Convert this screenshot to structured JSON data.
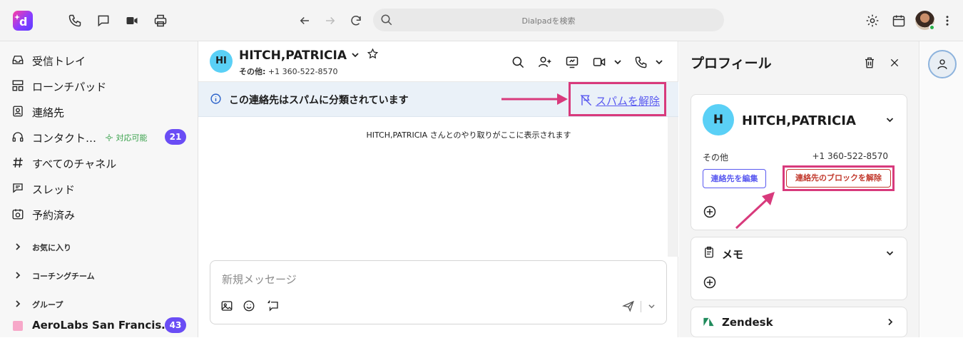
{
  "topbar": {
    "search_placeholder": "Dialpadを検索"
  },
  "sidebar": {
    "items": [
      {
        "label": "受信トレイ",
        "icon": "inbox-icon"
      },
      {
        "label": "ローンチパッド",
        "icon": "launchpad-icon"
      },
      {
        "label": "連絡先",
        "icon": "contacts-icon"
      },
      {
        "label": "コンタクト…",
        "icon": "headset-icon",
        "status": "対応可能",
        "badge": "21"
      },
      {
        "label": "すべてのチャネル",
        "icon": "hash-icon"
      },
      {
        "label": "スレッド",
        "icon": "threads-icon"
      },
      {
        "label": "予約済み",
        "icon": "scheduled-icon"
      }
    ],
    "sections": [
      {
        "label": "お気に入り"
      },
      {
        "label": "コーチングチーム"
      },
      {
        "label": "グループ"
      }
    ],
    "channel": {
      "label": "AeroLabs San Francis…",
      "badge": "43",
      "color": "#f7a8c9"
    }
  },
  "chat": {
    "avatar_initials": "HI",
    "contact_name": "HITCH,PATRICIA",
    "sub_label": "その他:",
    "phone": "+1 360-522-8570",
    "spam_message": "この連絡先はスパムに分類されています",
    "unspam_label": "スパムを解除",
    "empty_hint": "HITCH,PATRICIA さんとのやり取りがここに表示されます",
    "composer_placeholder": "新規メッセージ"
  },
  "profile": {
    "title": "プロフィール",
    "avatar_initial": "H",
    "name": "HITCH,PATRICIA",
    "phone_label": "その他",
    "phone": "+1 360-522-8570",
    "edit_contact": "連絡先を編集",
    "unblock_contact": "連絡先のブロックを解除",
    "memo_title": "メモ",
    "zendesk_title": "Zendesk"
  },
  "colors": {
    "accent": "#5a5af0",
    "badge": "#6a4df5",
    "highlight": "#d83a7c",
    "avatar": "#5ad0f6",
    "banner": "#eaf1f8"
  }
}
